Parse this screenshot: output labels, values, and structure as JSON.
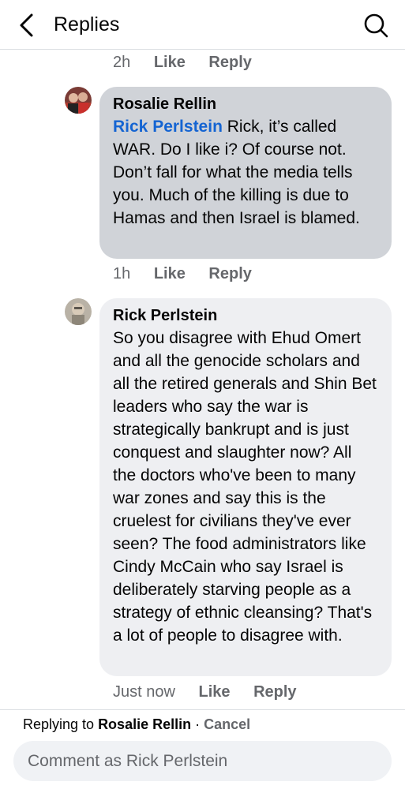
{
  "header": {
    "title": "Replies",
    "back_icon": "chevron-left-icon",
    "search_icon": "search-icon"
  },
  "top_meta": {
    "time": "2h",
    "like": "Like",
    "reply": "Reply"
  },
  "comments": [
    {
      "author": "Rosalie Rellin",
      "mention": "Rick Perlstein",
      "text": " Rick, it’s called WAR.  Do I like i?  Of course not. Don’t fall for what the media tells you.  Much of the killing is due to Hamas and then Israel is blamed.",
      "time": "1h",
      "like": "Like",
      "reply": "Reply"
    },
    {
      "author": "Rick Perlstein",
      "text": "So you disagree with Ehud Omert and all the genocide scholars and all the retired generals and Shin Bet leaders who say the war is strategically bankrupt and is just conquest and slaughter now? All the doctors who've been to many war zones and say this is the cruelest for civilians they've ever seen? The food administrators like Cindy McCain who say Israel is deliberately starving people as a strategy of ethnic cleansing? That's a lot of people to disagree with.",
      "time": "Just now",
      "like": "Like",
      "reply": "Reply"
    }
  ],
  "footer": {
    "replying_prefix": "Replying to ",
    "replying_name": "Rosalie Rellin",
    "separator": " · ",
    "cancel": "Cancel",
    "comment_placeholder": "Comment as Rick Perlstein"
  },
  "colors": {
    "mention": "#1464d2",
    "meta": "#65676b",
    "bubble_active": "#d0d3d8",
    "bubble": "#eeeff2"
  }
}
